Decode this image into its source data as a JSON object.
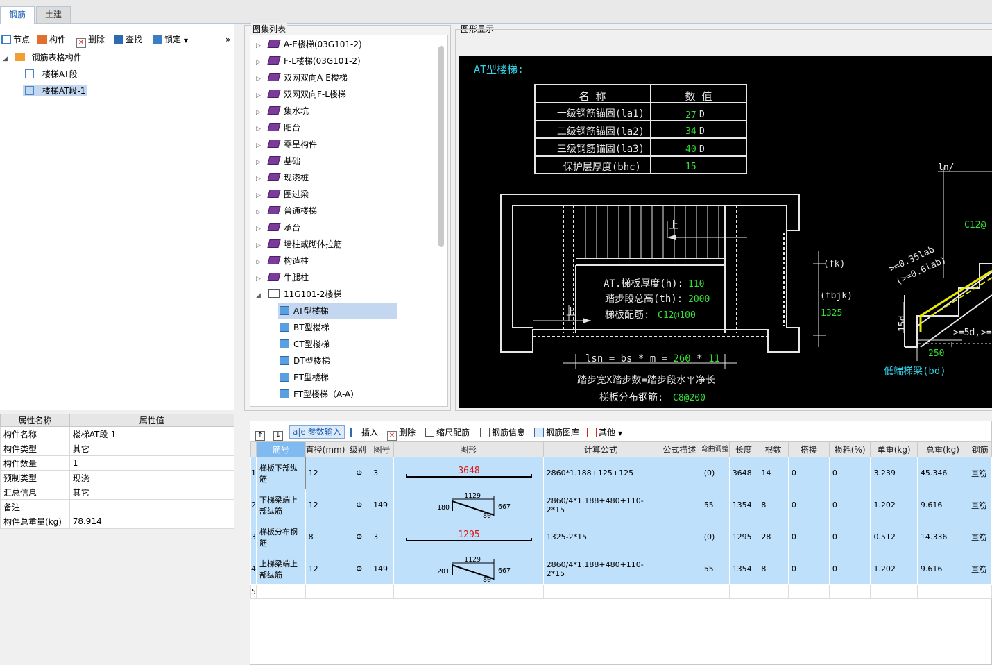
{
  "tabs": [
    {
      "label": "钢筋"
    },
    {
      "label": "土建"
    }
  ],
  "left_toolbar": {
    "node": "节点",
    "component": "构件",
    "delete": "删除",
    "find": "查找",
    "lock": "锁定",
    "more": "»"
  },
  "left_tree": {
    "root": "钢筋表格构件",
    "items": [
      "楼梯AT段",
      "楼梯AT段-1"
    ]
  },
  "properties": {
    "header_name": "属性名称",
    "header_value": "属性值",
    "rows": [
      {
        "name": "构件名称",
        "value": "楼梯AT段-1"
      },
      {
        "name": "构件类型",
        "value": "其它"
      },
      {
        "name": "构件数量",
        "value": "1"
      },
      {
        "name": "预制类型",
        "value": "现浇"
      },
      {
        "name": "汇总信息",
        "value": "其它"
      },
      {
        "name": "备注",
        "value": ""
      },
      {
        "name": "构件总重量(kg)",
        "value": "78.914"
      }
    ]
  },
  "atlas": {
    "title": "图集列表",
    "items": [
      "A-E楼梯(03G101-2)",
      "F-L楼梯(03G101-2)",
      "双网双向A-E楼梯",
      "双网双向F-L楼梯",
      "集水坑",
      "阳台",
      "零星构件",
      "基础",
      "现浇桩",
      "圈过梁",
      "普通楼梯",
      "承台",
      "墙柱或砌体拉筋",
      "构造柱",
      "牛腿柱",
      "11G101-2楼梯"
    ],
    "subitems": [
      "AT型楼梯",
      "BT型楼梯",
      "CT型楼梯",
      "DT型楼梯",
      "ET型楼梯",
      "FT型楼梯（A-A）"
    ]
  },
  "graphic": {
    "title": "图形显示",
    "heading": "AT型楼梯:",
    "table_head": [
      "名  称",
      "数  值"
    ],
    "table_rows": [
      {
        "name": "一级钢筋锚固(la1)",
        "value": "27",
        "unit": "D"
      },
      {
        "name": "二级钢筋锚固(la2)",
        "value": "34",
        "unit": "D"
      },
      {
        "name": "三级钢筋锚固(la3)",
        "value": "40",
        "unit": "D"
      },
      {
        "name": "保护层厚度(bhc)",
        "value": "15",
        "unit": ""
      }
    ],
    "up1": "上",
    "up2": "上",
    "thick_label": "AT.梯板厚度(h):",
    "thick_val": "110",
    "height_label": "踏步段总高(th):",
    "height_val": "2000",
    "rebar_label": "梯板配筋:",
    "rebar_val": "C12@100",
    "fk": "(fk)",
    "tbjk": "(tbjk)",
    "tbjk_val": "1325",
    "lsn_text": "lsn = bs * m = ",
    "lsn_bs": "260",
    "lsn_star": " * ",
    "lsn_m": "11",
    "step_text": "踏步宽X踏步数=踏步段水平净长",
    "dist_label": "梯板分布钢筋:",
    "dist_val": "C8@200",
    "ln": "ln/",
    "c12": "C12@",
    "anchor1": ">=0.35lab",
    "anchor2": "(>=0.6lab)",
    "d15": "15d",
    "d5": ">=5d,",
    "d5b": ">=",
    "w250": "250",
    "low_beam": "低端梯梁(bd)"
  },
  "bottom_toolbar": {
    "param_input": "参数输入",
    "insert": "插入",
    "delete": "删除",
    "scale": "缩尺配筋",
    "info": "钢筋信息",
    "library": "钢筋图库",
    "other": "其他"
  },
  "grid": {
    "headers": [
      "筋号",
      "直径(mm)",
      "级别",
      "图号",
      "图形",
      "计算公式",
      "公式描述",
      "弯曲调整",
      "长度",
      "根数",
      "搭接",
      "损耗(%)",
      "单重(kg)",
      "总重(kg)",
      "钢筋"
    ],
    "rows": [
      {
        "no": "1",
        "name": "梯板下部纵筋",
        "dia": "12",
        "grade": "Φ",
        "fig": "3",
        "shape_val": "3648",
        "formula": "2860*1.188+125+125",
        "desc": "",
        "bend": "(0)",
        "len": "3648",
        "count": "14",
        "lap": "0",
        "loss": "0",
        "unit": "3.239",
        "total": "45.346",
        "type": "直筋"
      },
      {
        "no": "2",
        "name": "下梯梁端上部纵筋",
        "dia": "12",
        "grade": "Φ",
        "fig": "149",
        "s_top": "1129",
        "s_left": "180",
        "s_right": "667",
        "s_bot": "80",
        "formula": "2860/4*1.188+480+110-2*15",
        "desc": "",
        "bend": "55",
        "len": "1354",
        "count": "8",
        "lap": "0",
        "loss": "0",
        "unit": "1.202",
        "total": "9.616",
        "type": "直筋"
      },
      {
        "no": "3",
        "name": "梯板分布钢筋",
        "dia": "8",
        "grade": "Φ",
        "fig": "3",
        "shape_val": "1295",
        "formula": "1325-2*15",
        "desc": "",
        "bend": "(0)",
        "len": "1295",
        "count": "28",
        "lap": "0",
        "loss": "0",
        "unit": "0.512",
        "total": "14.336",
        "type": "直筋"
      },
      {
        "no": "4",
        "name": "上梯梁端上部纵筋",
        "dia": "12",
        "grade": "Φ",
        "fig": "149",
        "s_top": "1129",
        "s_left": "201",
        "s_right": "667",
        "s_bot": "80",
        "formula": "2860/4*1.188+480+110-2*15",
        "desc": "",
        "bend": "55",
        "len": "1354",
        "count": "8",
        "lap": "0",
        "loss": "0",
        "unit": "1.202",
        "total": "9.616",
        "type": "直筋"
      }
    ],
    "empty_row": "5"
  },
  "colors": {
    "accent": "#1b5fb5",
    "selection": "#c4d7f0",
    "grid_row": "#bfe0fb",
    "cad_green": "#33e033",
    "cad_cyan": "#35d3e8",
    "cad_yellow": "#e8e800"
  }
}
